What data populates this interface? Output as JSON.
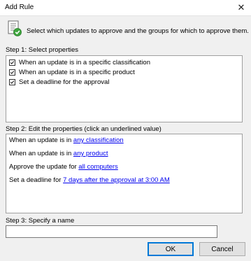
{
  "window": {
    "title": "Add Rule",
    "close_glyph": "✕"
  },
  "header": {
    "text": "Select which updates to approve and the groups for which to approve them.",
    "icon": "rule-document-icon"
  },
  "step1": {
    "label": "Step 1: Select properties",
    "properties": [
      {
        "label": "When an update is in a specific classification",
        "checked": true
      },
      {
        "label": "When an update is in a specific product",
        "checked": true
      },
      {
        "label": "Set a deadline for the approval",
        "checked": true
      }
    ]
  },
  "step2": {
    "label": "Step 2: Edit the properties (click an underlined value)",
    "rows": [
      {
        "prefix": "When an update is in ",
        "link": "any classification"
      },
      {
        "prefix": "When an update is in ",
        "link": "any product"
      },
      {
        "prefix": "Approve the update for ",
        "link": "all computers"
      },
      {
        "prefix": "Set a deadline for ",
        "link": "7 days after the approval at 3:00 AM"
      }
    ]
  },
  "step3": {
    "label": "Step 3: Specify a name",
    "value": ""
  },
  "buttons": {
    "ok": "OK",
    "cancel": "Cancel"
  },
  "colors": {
    "link": "#0000ee",
    "background": "#f0f0f0",
    "accent": "#0078d7"
  }
}
